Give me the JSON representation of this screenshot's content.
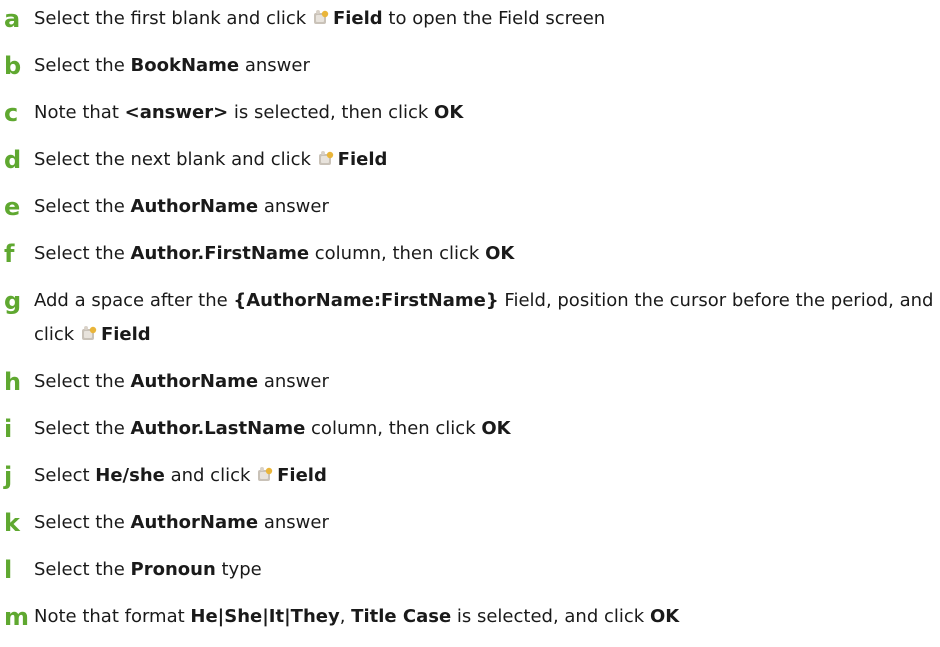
{
  "steps": [
    {
      "letter": "a",
      "parts": [
        {
          "t": "Select the first blank and click "
        },
        {
          "icon": "field-icon"
        },
        {
          "t": "Field",
          "b": true
        },
        {
          "t": " to open the Field screen"
        }
      ]
    },
    {
      "letter": "b",
      "parts": [
        {
          "t": "Select the "
        },
        {
          "t": "BookName",
          "b": true
        },
        {
          "t": " answer"
        }
      ]
    },
    {
      "letter": "c",
      "parts": [
        {
          "t": "Note that "
        },
        {
          "t": "<answer>",
          "b": true
        },
        {
          "t": " is selected, then click "
        },
        {
          "t": "OK",
          "b": true
        }
      ]
    },
    {
      "letter": "d",
      "parts": [
        {
          "t": "Select the next blank and click "
        },
        {
          "icon": "field-icon"
        },
        {
          "t": "Field",
          "b": true
        }
      ]
    },
    {
      "letter": "e",
      "parts": [
        {
          "t": "Select the "
        },
        {
          "t": "AuthorName",
          "b": true
        },
        {
          "t": " answer"
        }
      ]
    },
    {
      "letter": "f",
      "parts": [
        {
          "t": "Select the "
        },
        {
          "t": "Author.FirstName",
          "b": true
        },
        {
          "t": " column, then click "
        },
        {
          "t": "OK",
          "b": true
        }
      ]
    },
    {
      "letter": "g",
      "parts": [
        {
          "t": "Add a space after the "
        },
        {
          "t": "{AuthorName:FirstName}",
          "b": true
        },
        {
          "t": " Field, position the cursor before the period, and click "
        },
        {
          "icon": "field-icon"
        },
        {
          "t": "Field",
          "b": true
        }
      ]
    },
    {
      "letter": "h",
      "parts": [
        {
          "t": "Select the "
        },
        {
          "t": "AuthorName",
          "b": true
        },
        {
          "t": " answer"
        }
      ]
    },
    {
      "letter": "i",
      "parts": [
        {
          "t": "Select the "
        },
        {
          "t": "Author.LastName",
          "b": true
        },
        {
          "t": " column, then click "
        },
        {
          "t": "OK",
          "b": true
        }
      ]
    },
    {
      "letter": "j",
      "parts": [
        {
          "t": "Select "
        },
        {
          "t": "He/she",
          "b": true
        },
        {
          "t": " and click "
        },
        {
          "icon": "field-icon"
        },
        {
          "t": "Field",
          "b": true
        }
      ]
    },
    {
      "letter": "k",
      "parts": [
        {
          "t": "Select the "
        },
        {
          "t": "AuthorName",
          "b": true
        },
        {
          "t": " answer"
        }
      ]
    },
    {
      "letter": "l",
      "parts": [
        {
          "t": "Select the "
        },
        {
          "t": "Pronoun",
          "b": true
        },
        {
          "t": " type"
        }
      ]
    },
    {
      "letter": "m",
      "parts": [
        {
          "t": "Note that format "
        },
        {
          "t": "He|She|It|They",
          "b": true
        },
        {
          "t": ", "
        },
        {
          "t": "Title Case",
          "b": true
        },
        {
          "t": " is selected, and click "
        },
        {
          "t": "OK",
          "b": true
        }
      ]
    }
  ],
  "colors": {
    "letter": "#5fa830",
    "text": "#1a1a1a"
  }
}
